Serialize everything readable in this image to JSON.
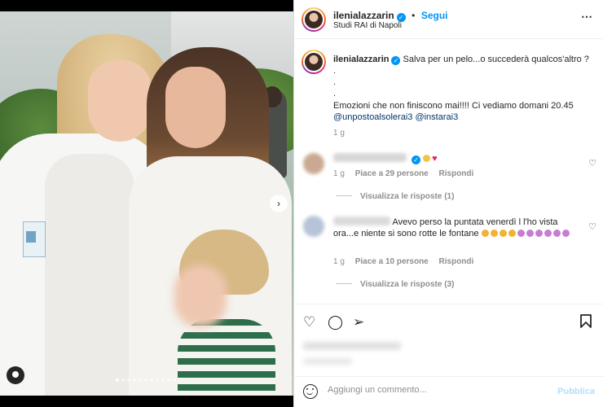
{
  "post": {
    "username": "ilenialazzarin",
    "verified_symbol": "✓",
    "follow_label": "Segui",
    "location": "Studi RAI di Napoli",
    "more_icon": "⋯"
  },
  "caption": {
    "username": "ilenialazzarin",
    "line1": "Salva per un pelo...o succederà qualcos'altro ?",
    "dot1": ".",
    "dot2": ".",
    "dot3": ".",
    "line2": "Emozioni che non finiscono mai!!!! Ci vediamo domani 20.45",
    "mentions": "@unpostoalsolerai3 @instarai3",
    "time": "1 g"
  },
  "comments": [
    {
      "emojis": [
        "#f5c542",
        "#e0245e"
      ],
      "time": "1 g",
      "likes": "Piace a 29 persone",
      "reply": "Rispondi",
      "view_replies": "Visualizza le risposte (1)"
    },
    {
      "text": "Avevo perso la puntata venerdì l l'ho vista ora...e niente si sono rotte le fontane",
      "time": "1 g",
      "likes": "Piace a 10 persone",
      "reply": "Rispondi",
      "view_replies": "Visualizza le risposte (3)"
    }
  ],
  "comment_box": {
    "placeholder": "Aggiungi un commento...",
    "publish_label": "Pubblica"
  },
  "icons": {
    "heart": "♡",
    "comment": "◯",
    "share": "➢",
    "save": "⚑",
    "next": "›"
  },
  "carousel": {
    "slides": 11,
    "active_index": 0
  },
  "colors": {
    "accent": "#0095f6",
    "publish_disabled": "#b2dffc"
  }
}
